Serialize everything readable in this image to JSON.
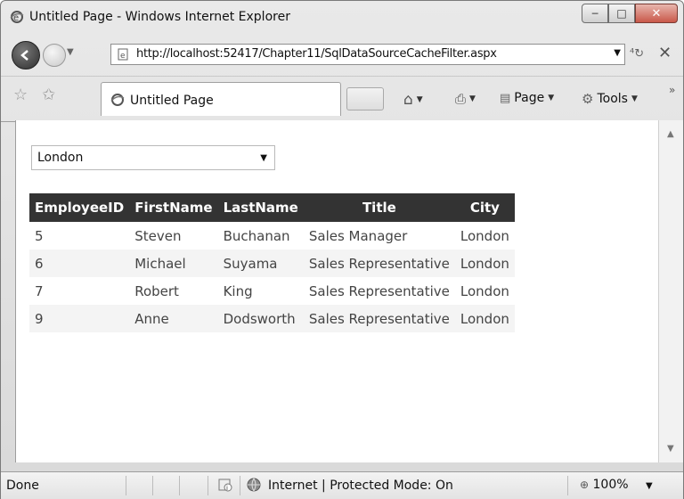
{
  "window": {
    "title": "Untitled Page - Windows Internet Explorer",
    "controls": {
      "minimize": "─",
      "maximize": "□",
      "close": "✕"
    }
  },
  "address": {
    "url": "http://localhost:52417/Chapter11/SqlDataSourceCacheFilter.aspx"
  },
  "commandbar": {
    "tab_label": "Untitled Page",
    "page_label": "Page",
    "tools_label": "Tools",
    "more": "»"
  },
  "filter": {
    "selected": "London"
  },
  "grid": {
    "columns": [
      "EmployeeID",
      "FirstName",
      "LastName",
      "Title",
      "City"
    ],
    "rows": [
      [
        "5",
        "Steven",
        "Buchanan",
        "Sales Manager",
        "London"
      ],
      [
        "6",
        "Michael",
        "Suyama",
        "Sales Representative",
        "London"
      ],
      [
        "7",
        "Robert",
        "King",
        "Sales Representative",
        "London"
      ],
      [
        "9",
        "Anne",
        "Dodsworth",
        "Sales Representative",
        "London"
      ]
    ]
  },
  "status": {
    "text": "Done",
    "zone": "Internet | Protected Mode: On",
    "zoom": "100%"
  },
  "colors": {
    "grid_header_bg": "#333333",
    "grid_header_text": "#ffffff",
    "row_alt_bg": "#f4f4f4"
  }
}
